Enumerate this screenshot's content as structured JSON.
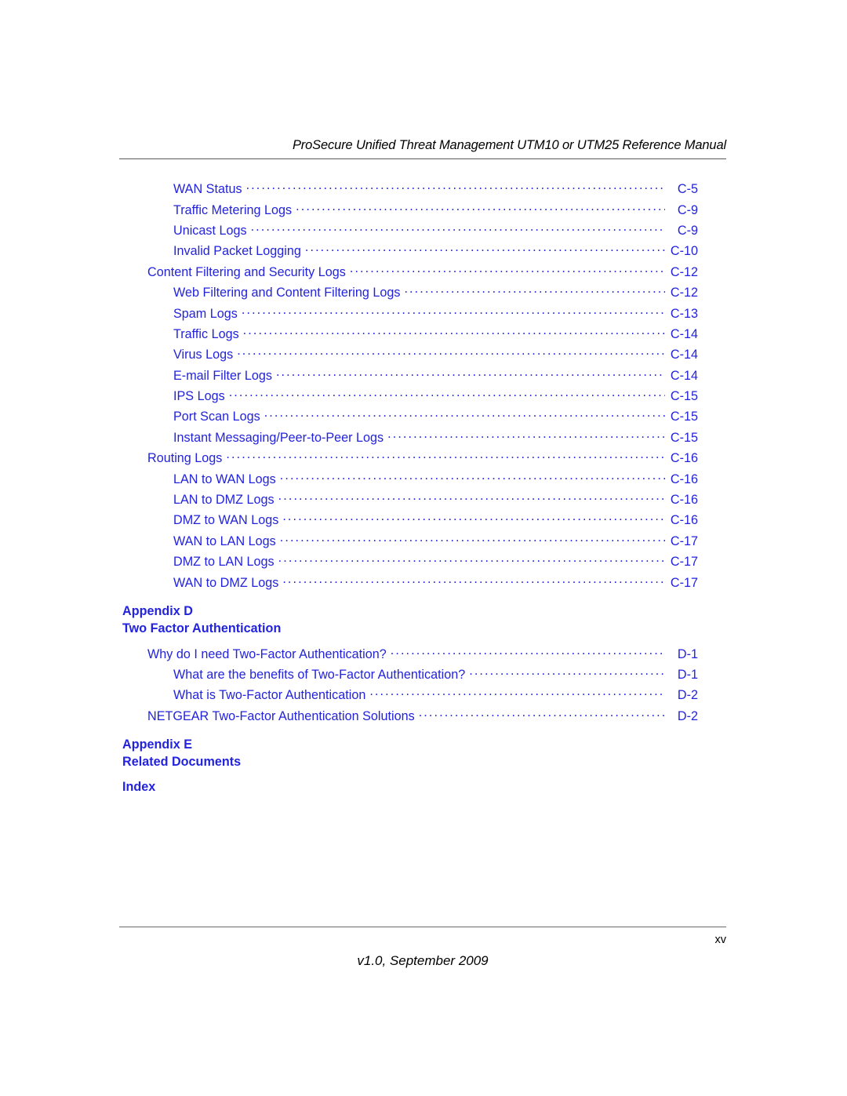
{
  "header": {
    "title": "ProSecure Unified Threat Management UTM10 or UTM25 Reference Manual"
  },
  "toc": {
    "entries": [
      {
        "title": "WAN Status",
        "page": "C-5",
        "level": 2
      },
      {
        "title": "Traffic Metering Logs",
        "page": "C-9",
        "level": 2
      },
      {
        "title": "Unicast Logs",
        "page": "C-9",
        "level": 2
      },
      {
        "title": "Invalid Packet Logging",
        "page": "C-10",
        "level": 2
      },
      {
        "title": "Content Filtering and Security Logs",
        "page": "C-12",
        "level": 1
      },
      {
        "title": "Web Filtering and Content Filtering Logs",
        "page": "C-12",
        "level": 2
      },
      {
        "title": "Spam Logs",
        "page": "C-13",
        "level": 2
      },
      {
        "title": "Traffic Logs",
        "page": "C-14",
        "level": 2
      },
      {
        "title": "Virus Logs",
        "page": "C-14",
        "level": 2
      },
      {
        "title": "E-mail Filter Logs",
        "page": "C-14",
        "level": 2
      },
      {
        "title": "IPS Logs",
        "page": "C-15",
        "level": 2
      },
      {
        "title": "Port Scan Logs",
        "page": "C-15",
        "level": 2
      },
      {
        "title": "Instant Messaging/Peer-to-Peer Logs",
        "page": "C-15",
        "level": 2
      },
      {
        "title": "Routing Logs",
        "page": "C-16",
        "level": 1
      },
      {
        "title": "LAN to WAN Logs",
        "page": "C-16",
        "level": 2
      },
      {
        "title": "LAN to DMZ Logs",
        "page": "C-16",
        "level": 2
      },
      {
        "title": "DMZ to WAN Logs",
        "page": "C-16",
        "level": 2
      },
      {
        "title": "WAN to LAN Logs",
        "page": "C-17",
        "level": 2
      },
      {
        "title": "DMZ to LAN Logs",
        "page": "C-17",
        "level": 2
      },
      {
        "title": "WAN to DMZ Logs",
        "page": "C-17",
        "level": 2
      }
    ],
    "appendix_d": {
      "label": "Appendix D",
      "title": "Two Factor Authentication",
      "entries": [
        {
          "title": "Why do I need Two-Factor Authentication?",
          "page": "D-1",
          "level": 1
        },
        {
          "title": "What are the benefits of Two-Factor Authentication?",
          "page": "D-1",
          "level": 2
        },
        {
          "title": "What is Two-Factor Authentication",
          "page": "D-2",
          "level": 2
        },
        {
          "title": "NETGEAR Two-Factor Authentication Solutions",
          "page": "D-2",
          "level": 1
        }
      ]
    },
    "appendix_e": {
      "label": "Appendix E",
      "title": "Related Documents"
    },
    "index": {
      "label": "Index"
    }
  },
  "footer": {
    "page_number": "xv",
    "version": "v1.0, September 2009"
  },
  "colors": {
    "link_blue": "#2323dc",
    "text_black": "#000000",
    "rule_gray": "#5b5b5b"
  }
}
